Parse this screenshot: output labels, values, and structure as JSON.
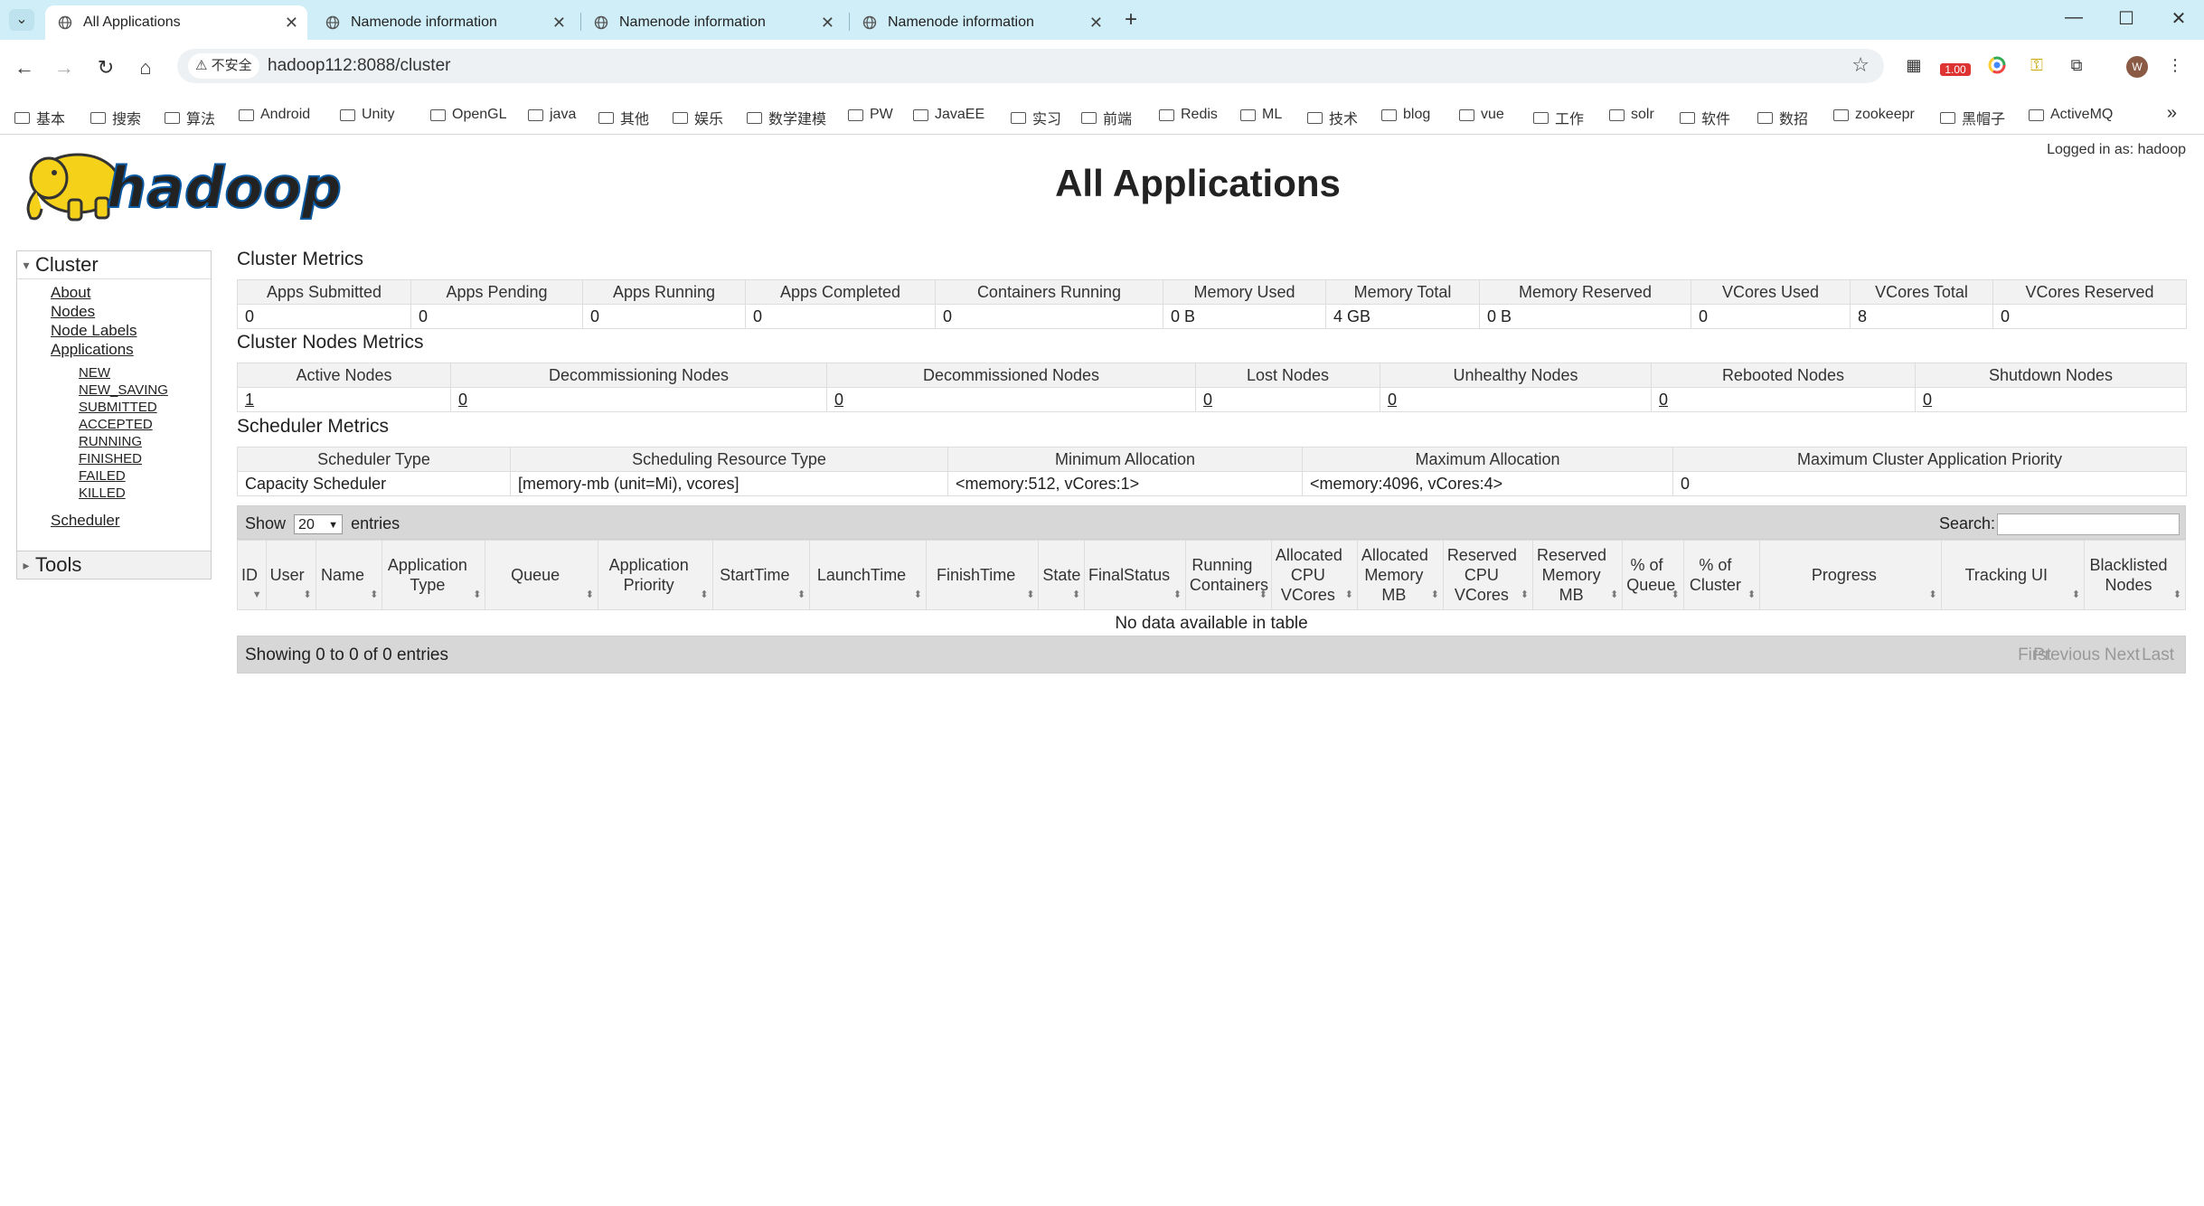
{
  "browser": {
    "tabs": [
      {
        "label": "All Applications",
        "active": true
      },
      {
        "label": "Namenode information",
        "active": false
      },
      {
        "label": "Namenode information",
        "active": false
      },
      {
        "label": "Namenode information",
        "active": false
      }
    ],
    "security_label": "不安全",
    "url": "hadoop112:8088/cluster",
    "profile_initial": "W",
    "ext_badge": "1.00",
    "bookmarks": [
      "基本",
      "搜索",
      "算法",
      "Android",
      "Unity",
      "OpenGL",
      "java",
      "其他",
      "娱乐",
      "数学建模",
      "PW",
      "JavaEE",
      "实习",
      "前端",
      "Redis",
      "ML",
      "技术",
      "blog",
      "vue",
      "工作",
      "solr",
      "软件",
      "数招",
      "zookeepr",
      "黑帽子",
      "ActiveMQ"
    ]
  },
  "page": {
    "logged_in": "Logged in as: hadoop",
    "title": "All Applications",
    "logo_text": "hadoop"
  },
  "sidebar": {
    "cluster_label": "Cluster",
    "links": [
      "About",
      "Nodes",
      "Node Labels",
      "Applications"
    ],
    "app_states": [
      "NEW",
      "NEW_SAVING",
      "SUBMITTED",
      "ACCEPTED",
      "RUNNING",
      "FINISHED",
      "FAILED",
      "KILLED"
    ],
    "scheduler": "Scheduler",
    "tools_label": "Tools"
  },
  "cluster_metrics": {
    "title": "Cluster Metrics",
    "headers": [
      "Apps Submitted",
      "Apps Pending",
      "Apps Running",
      "Apps Completed",
      "Containers Running",
      "Memory Used",
      "Memory Total",
      "Memory Reserved",
      "VCores Used",
      "VCores Total",
      "VCores Reserved"
    ],
    "values": [
      "0",
      "0",
      "0",
      "0",
      "0",
      "0 B",
      "4 GB",
      "0 B",
      "0",
      "8",
      "0"
    ]
  },
  "node_metrics": {
    "title": "Cluster Nodes Metrics",
    "headers": [
      "Active Nodes",
      "Decommissioning Nodes",
      "Decommissioned Nodes",
      "Lost Nodes",
      "Unhealthy Nodes",
      "Rebooted Nodes",
      "Shutdown Nodes"
    ],
    "values": [
      "1",
      "0",
      "0",
      "0",
      "0",
      "0",
      "0"
    ]
  },
  "scheduler_metrics": {
    "title": "Scheduler Metrics",
    "headers": [
      "Scheduler Type",
      "Scheduling Resource Type",
      "Minimum Allocation",
      "Maximum Allocation",
      "Maximum Cluster Application Priority"
    ],
    "values": [
      "Capacity Scheduler",
      "[memory-mb (unit=Mi), vcores]",
      "<memory:512, vCores:1>",
      "<memory:4096, vCores:4>",
      "0"
    ]
  },
  "apps_table": {
    "show_label": "Show",
    "entries_value": "20",
    "entries_label": "entries",
    "search_label": "Search:",
    "columns": [
      "ID",
      "User",
      "Name",
      "Application Type",
      "Queue",
      "Application Priority",
      "StartTime",
      "LaunchTime",
      "FinishTime",
      "State",
      "FinalStatus",
      "Running Containers",
      "Allocated CPU VCores",
      "Allocated Memory MB",
      "Reserved CPU VCores",
      "Reserved Memory MB",
      "% of Queue",
      "% of Cluster",
      "Progress",
      "Tracking UI",
      "Blacklisted Nodes"
    ],
    "empty_message": "No data available in table",
    "info": "Showing 0 to 0 of 0 entries",
    "pager": [
      "First",
      "Previous",
      "Next",
      "Last"
    ]
  }
}
